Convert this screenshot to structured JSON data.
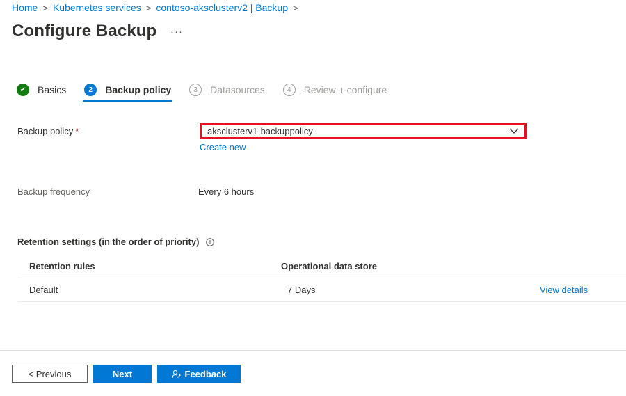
{
  "breadcrumb": {
    "items": [
      "Home",
      "Kubernetes services",
      "contoso-aksclusterv2 | Backup"
    ]
  },
  "header": {
    "title": "Configure Backup",
    "more": "···"
  },
  "steps": [
    {
      "number": "✔",
      "label": "Basics",
      "state": "done"
    },
    {
      "number": "2",
      "label": "Backup policy",
      "state": "active"
    },
    {
      "number": "3",
      "label": "Datasources",
      "state": "future"
    },
    {
      "number": "4",
      "label": "Review + configure",
      "state": "future"
    }
  ],
  "form": {
    "backup_policy_label": "Backup policy",
    "required_mark": "*",
    "backup_policy_value": "aksclusterv1-backuppolicy",
    "create_new": "Create new",
    "backup_frequency_label": "Backup frequency",
    "backup_frequency_value": "Every 6 hours"
  },
  "retention": {
    "title": "Retention settings (in the order of priority)",
    "columns": [
      "Retention rules",
      "Operational data store"
    ],
    "rows": [
      {
        "rule": "Default",
        "store": "7 Days",
        "action": "View details"
      }
    ]
  },
  "footer": {
    "previous": "< Previous",
    "next": "Next",
    "feedback": "Feedback"
  },
  "colors": {
    "accent": "#0078d4",
    "success": "#107c10",
    "highlight": "#e81123",
    "required": "#a4262c"
  }
}
